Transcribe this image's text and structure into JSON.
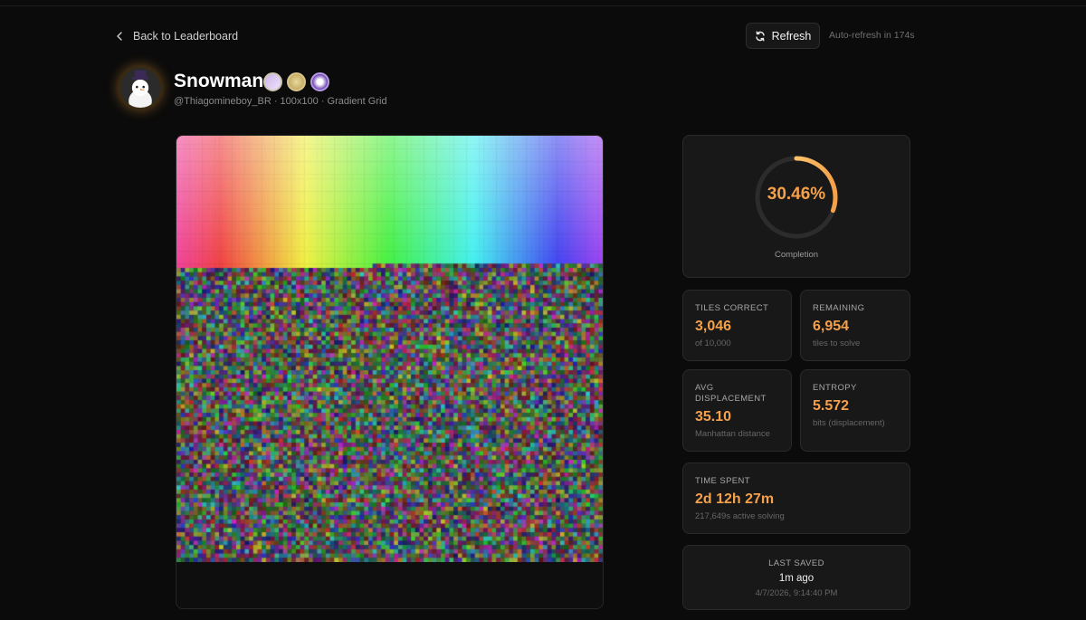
{
  "nav": {
    "back_label": "Back to Leaderboard"
  },
  "toolbar": {
    "refresh_label": "Refresh",
    "auto_refresh": "Auto-refresh in 174s"
  },
  "profile": {
    "name": "Snowman",
    "subline": "@Thiagomineboy_BR · 100x100 · Gradient Grid",
    "badges": [
      "badge-icon",
      "badge-icon",
      "badge-icon"
    ]
  },
  "puzzle": {
    "grid_size": 100,
    "solved_rows": 30,
    "solved_extra_tiles": 46,
    "accent_color": "#f5a04a"
  },
  "completion": {
    "value": "30.46%",
    "fraction": 0.3046,
    "label": "Completion"
  },
  "stats": {
    "tiles_correct": {
      "label": "TILES CORRECT",
      "value": "3,046",
      "sub": "of 10,000"
    },
    "remaining": {
      "label": "REMAINING",
      "value": "6,954",
      "sub": "tiles to solve"
    },
    "avg_displacement": {
      "label": "AVG DISPLACEMENT",
      "value": "35.10",
      "sub": "Manhattan distance"
    },
    "entropy": {
      "label": "ENTROPY",
      "value": "5.572",
      "sub": "bits (displacement)"
    },
    "time_spent": {
      "label": "TIME SPENT",
      "value": "2d 12h 27m",
      "sub": "217,649s active solving"
    },
    "last_saved": {
      "label": "LAST SAVED",
      "value": "1m ago",
      "sub": "4/7/2026, 9:14:40 PM"
    }
  }
}
